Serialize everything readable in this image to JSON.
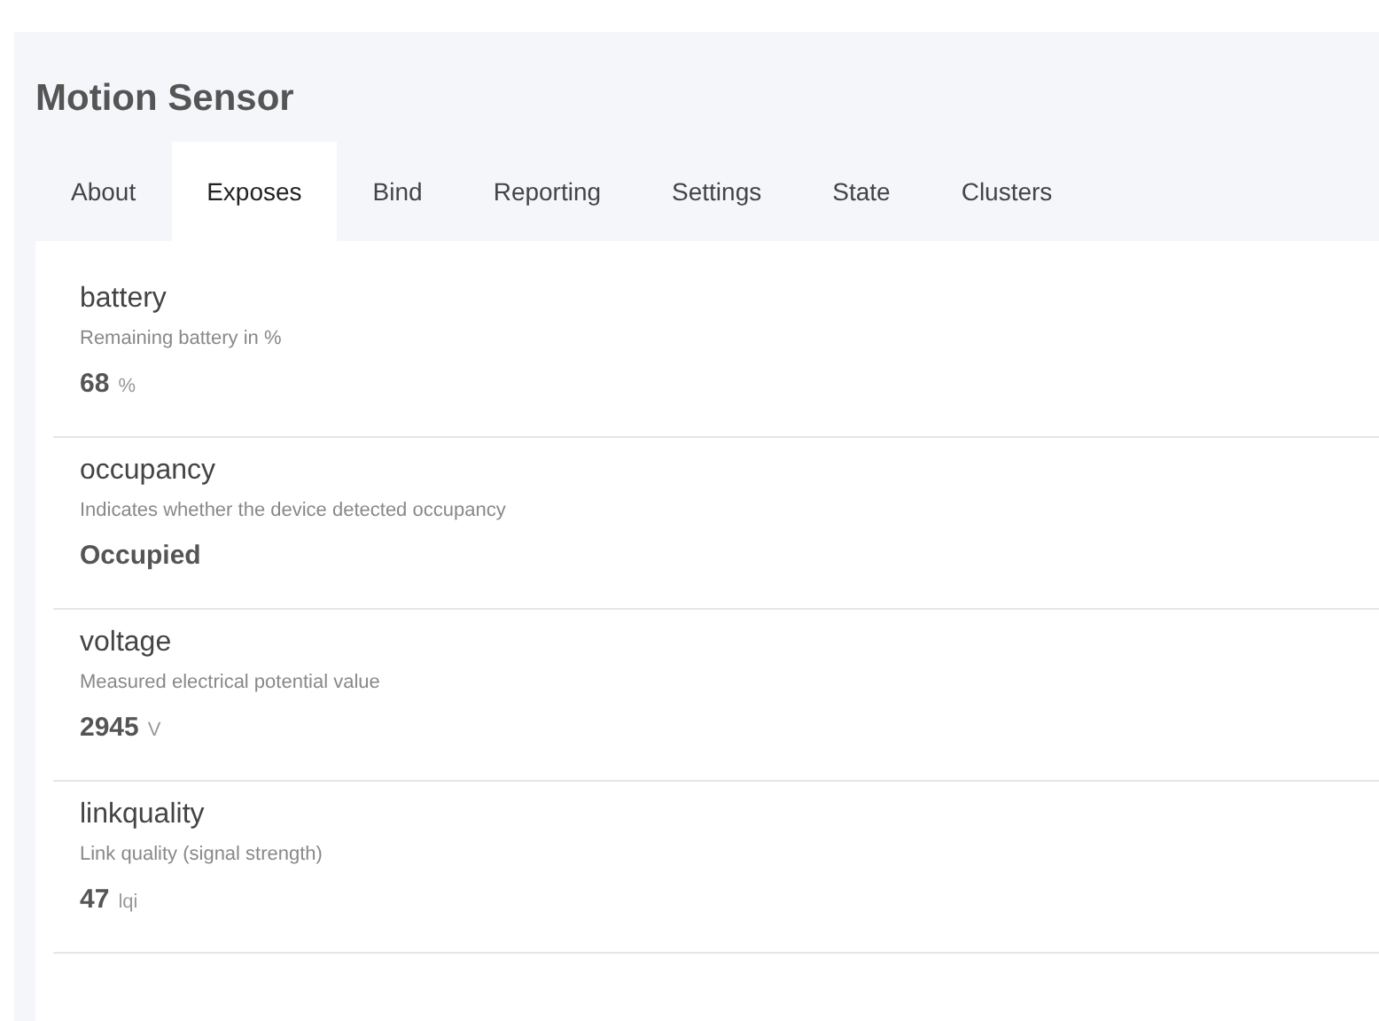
{
  "title": "Motion Sensor",
  "tabs": [
    {
      "label": "About",
      "selected": false
    },
    {
      "label": "Exposes",
      "selected": true
    },
    {
      "label": "Bind",
      "selected": false
    },
    {
      "label": "Reporting",
      "selected": false
    },
    {
      "label": "Settings",
      "selected": false
    },
    {
      "label": "State",
      "selected": false
    },
    {
      "label": "Clusters",
      "selected": false
    }
  ],
  "exposes": [
    {
      "name": "battery",
      "description": "Remaining battery in %",
      "value": "68",
      "unit": "%"
    },
    {
      "name": "occupancy",
      "description": "Indicates whether the device detected occupancy",
      "value": "Occupied"
    },
    {
      "name": "voltage",
      "description": "Measured electrical potential value",
      "value": "2945",
      "unit": "V"
    },
    {
      "name": "linkquality",
      "description": "Link quality (signal strength)",
      "value": "47",
      "unit": "lqi"
    }
  ]
}
